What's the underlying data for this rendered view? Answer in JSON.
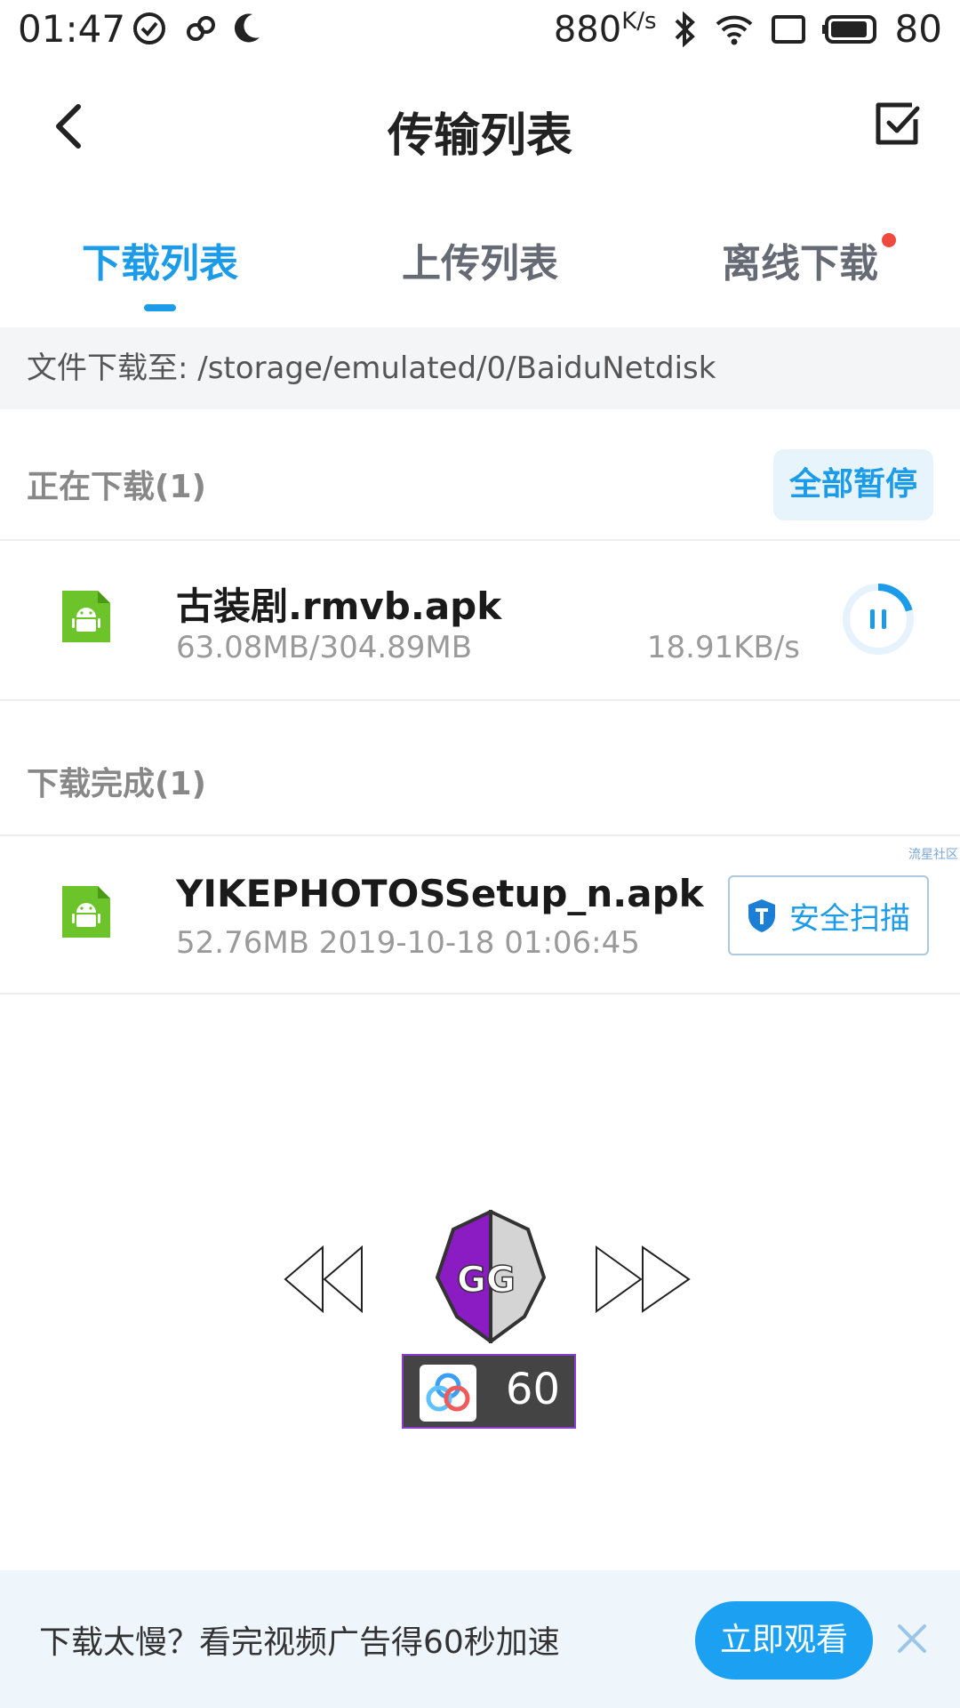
{
  "status_bar": {
    "time": "01:47",
    "speed": "880",
    "speed_unit": "K/s",
    "battery": "80"
  },
  "header": {
    "title": "传输列表"
  },
  "tabs": [
    {
      "label": "下载列表",
      "active": true
    },
    {
      "label": "上传列表",
      "active": false
    },
    {
      "label": "离线下载",
      "active": false,
      "badge": true
    }
  ],
  "path": "文件下载至: /storage/emulated/0/BaiduNetdisk",
  "downloading": {
    "title": "正在下载(1)",
    "pause_all_label": "全部暂停",
    "items": [
      {
        "name": "古装剧.rmvb.apk",
        "progress_text": "63.08MB/304.89MB",
        "speed": "18.91KB/s",
        "progress": 0.207
      }
    ]
  },
  "completed": {
    "title": "下载完成(1)",
    "items": [
      {
        "name": "YIKEPHOTOSSetup_n.apk",
        "meta": "52.76MB 2019-10-18 01:06:45",
        "scan_label": "安全扫描"
      }
    ]
  },
  "ad_mark": "流星社区",
  "overlay": {
    "logo_text": "GG",
    "fps": "60"
  },
  "banner": {
    "text": "下载太慢？看完视频广告得60秒加速",
    "button_label": "立即观看"
  },
  "colors": {
    "accent": "#1c9be8",
    "apk_green": "#6cc42a",
    "badge_red": "#f04a3f"
  }
}
